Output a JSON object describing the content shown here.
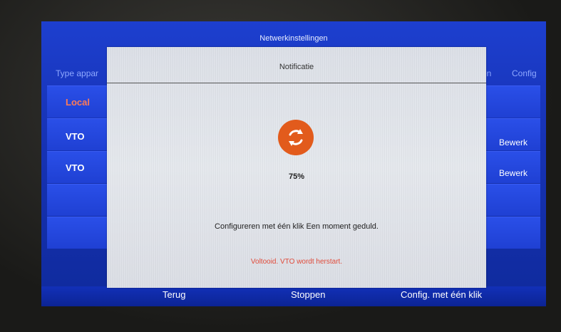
{
  "window": {
    "title": "Netwerkinstellingen"
  },
  "table": {
    "header_left": "Type appar",
    "header_right": [
      "en",
      "Config"
    ],
    "rows": [
      {
        "label": "Local",
        "edit": ""
      },
      {
        "label": "VTO",
        "edit": "Bewerk"
      },
      {
        "label": "VTO",
        "edit": "Bewerk"
      }
    ]
  },
  "bottom": {
    "back": "Terug",
    "stop": "Stoppen",
    "one_click": "Config. met één klik"
  },
  "dialog": {
    "title": "Notificatie",
    "progress_text": "75%",
    "progress": 0.75,
    "message": "Configureren met één klik Een moment geduld.",
    "status": "Voltooid. VTO wordt herstart."
  },
  "icons": {
    "spinner": "refresh-icon"
  },
  "colors": {
    "spinner": "#e25b1c",
    "status": "#e04b3a",
    "local_row": "#ff7b56"
  }
}
